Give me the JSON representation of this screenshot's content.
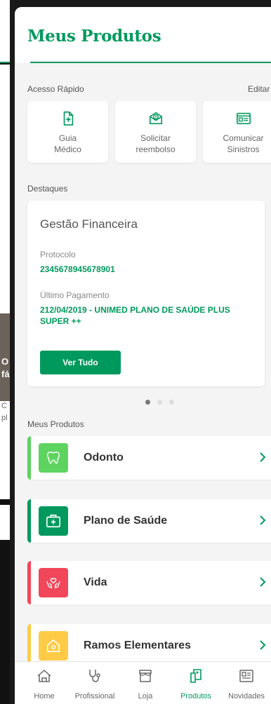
{
  "header": {
    "title": "Meus Produtos"
  },
  "quick_access": {
    "label": "Acesso Rápido",
    "edit_label": "Editar",
    "items": [
      {
        "label": "Guia\nMédico",
        "icon": "medical-guide-icon"
      },
      {
        "label": "Solicitar\nreembolso",
        "icon": "refund-icon"
      },
      {
        "label": "Comunicar\nSinistros",
        "icon": "claims-icon"
      }
    ]
  },
  "highlights": {
    "label": "Destaques",
    "card": {
      "title": "Gestão Financeira",
      "protocol_label": "Protocolo",
      "protocol_value": "2345678945678901",
      "last_payment_label": "Último Pagamento",
      "last_payment_value": "212/04/2019 - UNIMED PLANO DE SAÚDE PLUS SUPER ++",
      "button_label": "Ver Tudo"
    },
    "pager": {
      "count": 3,
      "active": 0
    }
  },
  "products": {
    "label": "Meus Produtos",
    "items": [
      {
        "name": "Odonto",
        "color": "#5fd35f",
        "icon": "tooth-icon"
      },
      {
        "name": "Plano de Saúde",
        "color": "#00995d",
        "icon": "first-aid-kit-icon"
      },
      {
        "name": "Vida",
        "color": "#f2465a",
        "icon": "hands-heart-icon"
      },
      {
        "name": "Ramos Elementares",
        "color": "#ffcb47",
        "icon": "house-heart-icon"
      }
    ]
  },
  "tabbar": {
    "items": [
      {
        "label": "Home",
        "icon": "home-icon"
      },
      {
        "label": "Profissional",
        "icon": "stethoscope-icon"
      },
      {
        "label": "Loja",
        "icon": "store-icon"
      },
      {
        "label": "Produtos",
        "icon": "products-icon",
        "active": true
      },
      {
        "label": "Novidades",
        "icon": "news-icon"
      }
    ]
  },
  "background": {
    "photo_text_1": "O",
    "photo_text_2": "fá",
    "caption_1": "C",
    "caption_2": "pl"
  },
  "colors": {
    "brand": "#00995d",
    "text": "#333333",
    "muted": "#666666"
  }
}
